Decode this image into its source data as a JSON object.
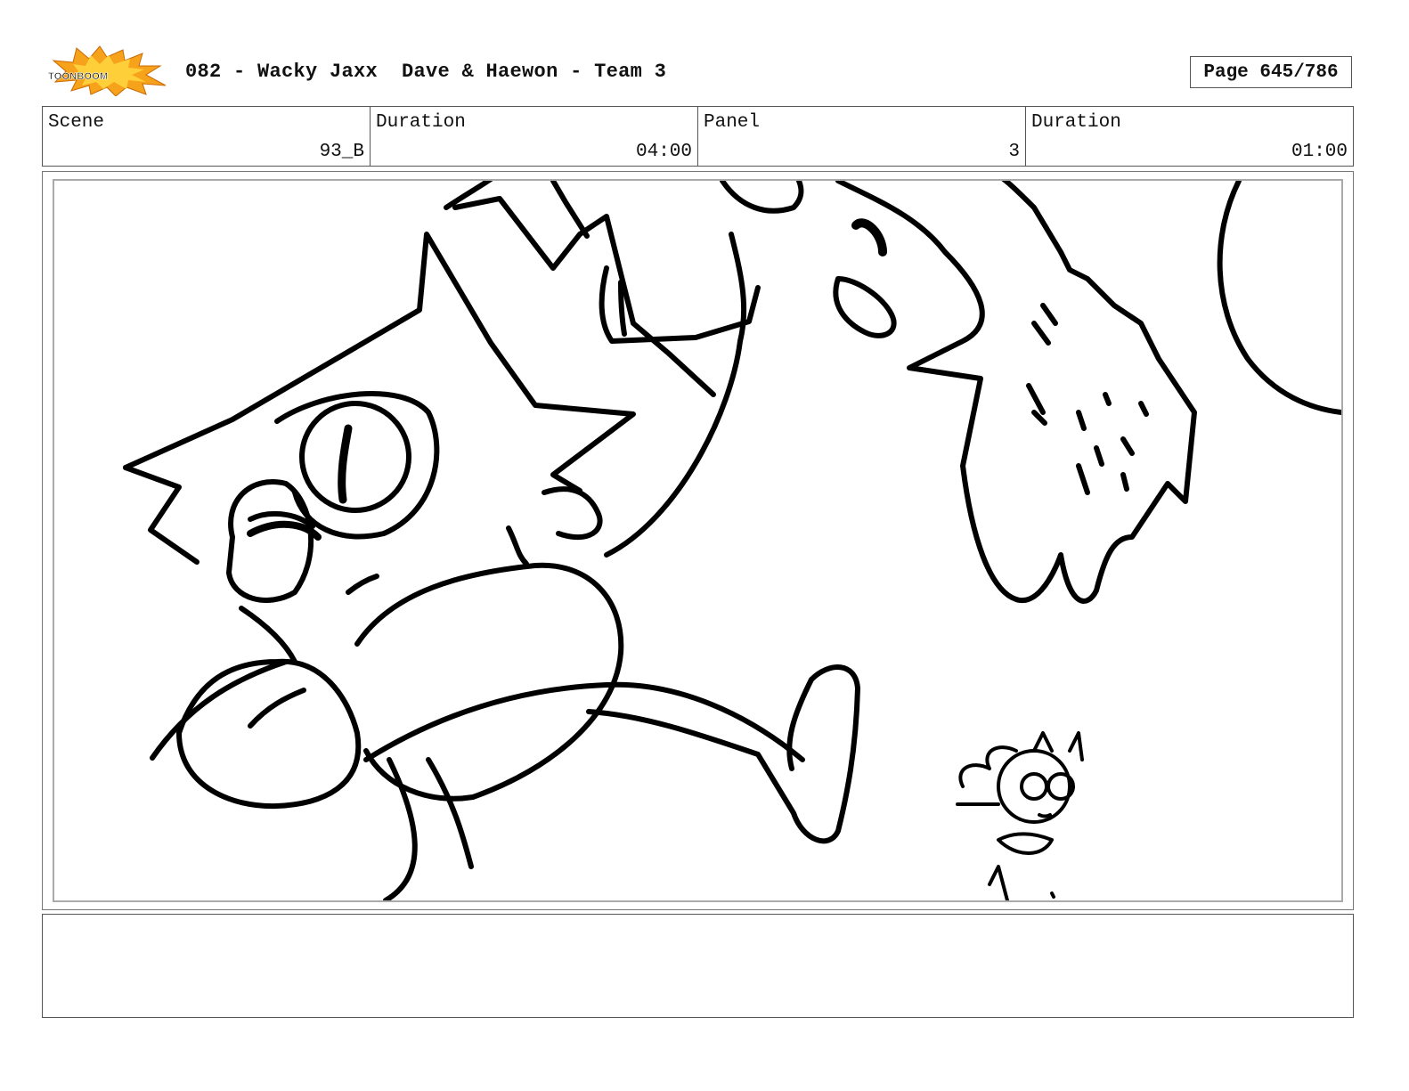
{
  "header": {
    "logo_text": "TOONBOOM",
    "logo_colors": {
      "burst_outer": "#f7a21b",
      "burst_inner": "#ffcf3a",
      "outline": "#111111"
    },
    "title": "082 - Wacky Jaxx  Dave & Haewon - Team 3",
    "page_label": "Page 645/786"
  },
  "info": {
    "scene_label": "Scene",
    "scene_value": "93_B",
    "duration_label": "Duration",
    "duration_value": "04:00",
    "panel_label": "Panel",
    "panel_value": "3",
    "panel_duration_label": "Duration",
    "panel_duration_value": "01:00"
  },
  "notes": {
    "text": ""
  }
}
